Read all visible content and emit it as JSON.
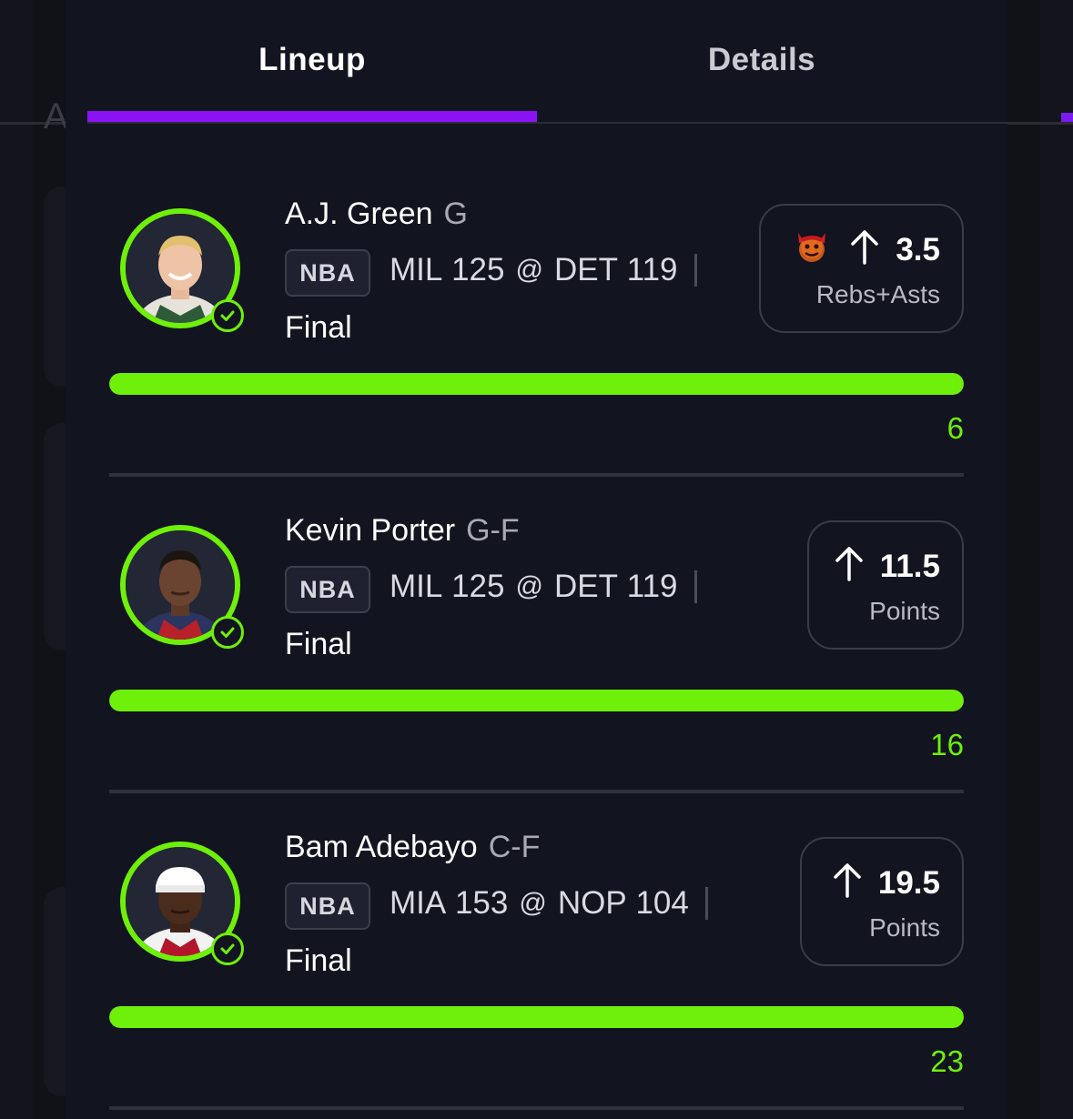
{
  "tabs": [
    {
      "label": "Lineup",
      "active": true
    },
    {
      "label": "Details",
      "active": false
    }
  ],
  "colors": {
    "accent_purple": "#8a12f5",
    "success_green": "#6ef00a",
    "background": "#121420"
  },
  "picks": [
    {
      "player": "A.J. Green",
      "position": "G",
      "league": "NBA",
      "away_team": "MIL",
      "away_score": "125",
      "at": "@",
      "home_team": "DET",
      "home_score": "119",
      "status": "Final",
      "direction_icon": "arrow-up-icon",
      "line": "3.5",
      "stat": "Rebs+Asts",
      "special_icon": "demon-icon",
      "actual": "6",
      "progress": 1.0
    },
    {
      "player": "Kevin Porter",
      "position": "G-F",
      "league": "NBA",
      "away_team": "MIL",
      "away_score": "125",
      "at": "@",
      "home_team": "DET",
      "home_score": "119",
      "status": "Final",
      "direction_icon": "arrow-up-icon",
      "line": "11.5",
      "stat": "Points",
      "actual": "16",
      "progress": 1.0
    },
    {
      "player": "Bam Adebayo",
      "position": "C-F",
      "league": "NBA",
      "away_team": "MIA",
      "away_score": "153",
      "at": "@",
      "home_team": "NOP",
      "home_score": "104",
      "status": "Final",
      "direction_icon": "arrow-up-icon",
      "line": "19.5",
      "stat": "Points",
      "actual": "23",
      "progress": 1.0
    }
  ],
  "background": {
    "partial_letter": "A"
  }
}
